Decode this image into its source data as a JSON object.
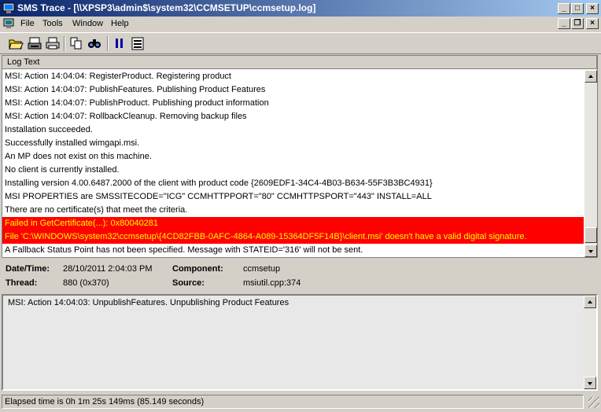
{
  "window": {
    "title": "SMS Trace - [\\\\XPSP3\\admin$\\system32\\CCMSETUP\\ccmsetup.log]",
    "buttons": {
      "minimize": "_",
      "maximize": "□",
      "close": "×"
    }
  },
  "menu": {
    "items": [
      "File",
      "Tools",
      "Window",
      "Help"
    ],
    "doc_buttons": {
      "minimize": "_",
      "restore": "❐",
      "close": "×"
    }
  },
  "toolbar": {
    "icons": [
      "open-folder-icon",
      "print-setup-icon",
      "print-icon",
      "copy-icon",
      "find-icon",
      "pause-icon",
      "highlight-icon"
    ]
  },
  "log": {
    "column_header": "Log Text",
    "rows": [
      {
        "text": "MSI: Action 14:04:04: RegisterProduct. Registering product",
        "error": false
      },
      {
        "text": "MSI: Action 14:04:07: PublishFeatures. Publishing Product Features",
        "error": false
      },
      {
        "text": "MSI: Action 14:04:07: PublishProduct. Publishing product information",
        "error": false
      },
      {
        "text": "MSI: Action 14:04:07: RollbackCleanup. Removing backup files",
        "error": false
      },
      {
        "text": "Installation succeeded.",
        "error": false
      },
      {
        "text": "Successfully installed wimgapi.msi.",
        "error": false
      },
      {
        "text": "An MP does not exist on this machine.",
        "error": false
      },
      {
        "text": "No client is currently installed.",
        "error": false
      },
      {
        "text": "Installing version 4.00.6487.2000 of the client with product code {2609EDF1-34C4-4B03-B634-55F3B3BC4931}",
        "error": false
      },
      {
        "text": "MSI PROPERTIES are  SMSSITECODE=\"ICG\" CCMHTTPPORT=\"80\" CCMHTTPSPORT=\"443\" INSTALL=ALL",
        "error": false
      },
      {
        "text": "There are no certificate(s) that meet the criteria.",
        "error": false
      },
      {
        "text": "Failed in GetCertificate(...): 0x80040281",
        "error": true
      },
      {
        "text": "File 'C:\\WINDOWS\\system32\\ccmsetup\\{4CD82FBB-0AFC-4864-A089-15364DF5F14B}\\client.msi' doesn't have a valid digital signature.",
        "error": true
      },
      {
        "text": "A Fallback Status Point has not been specified.  Message with STATEID='316' will not be sent.",
        "error": false
      }
    ]
  },
  "details": {
    "datetime_label": "Date/Time:",
    "datetime_value": "28/10/2011 2:04:03 PM",
    "component_label": "Component:",
    "component_value": "ccmsetup",
    "thread_label": "Thread:",
    "thread_value": "880 (0x370)",
    "source_label": "Source:",
    "source_value": "msiutil.cpp:374"
  },
  "message": {
    "text": "MSI: Action 14:04:03: UnpublishFeatures. Unpublishing Product Features"
  },
  "status": {
    "text": "Elapsed time is 0h 1m 25s 149ms (85.149 seconds)"
  },
  "colors": {
    "title_gradient_start": "#0a246a",
    "title_gradient_end": "#a6caf0",
    "error_row_bg": "#ff0000",
    "error_row_text": "#ffff00",
    "chrome": "#d4d0c8"
  }
}
